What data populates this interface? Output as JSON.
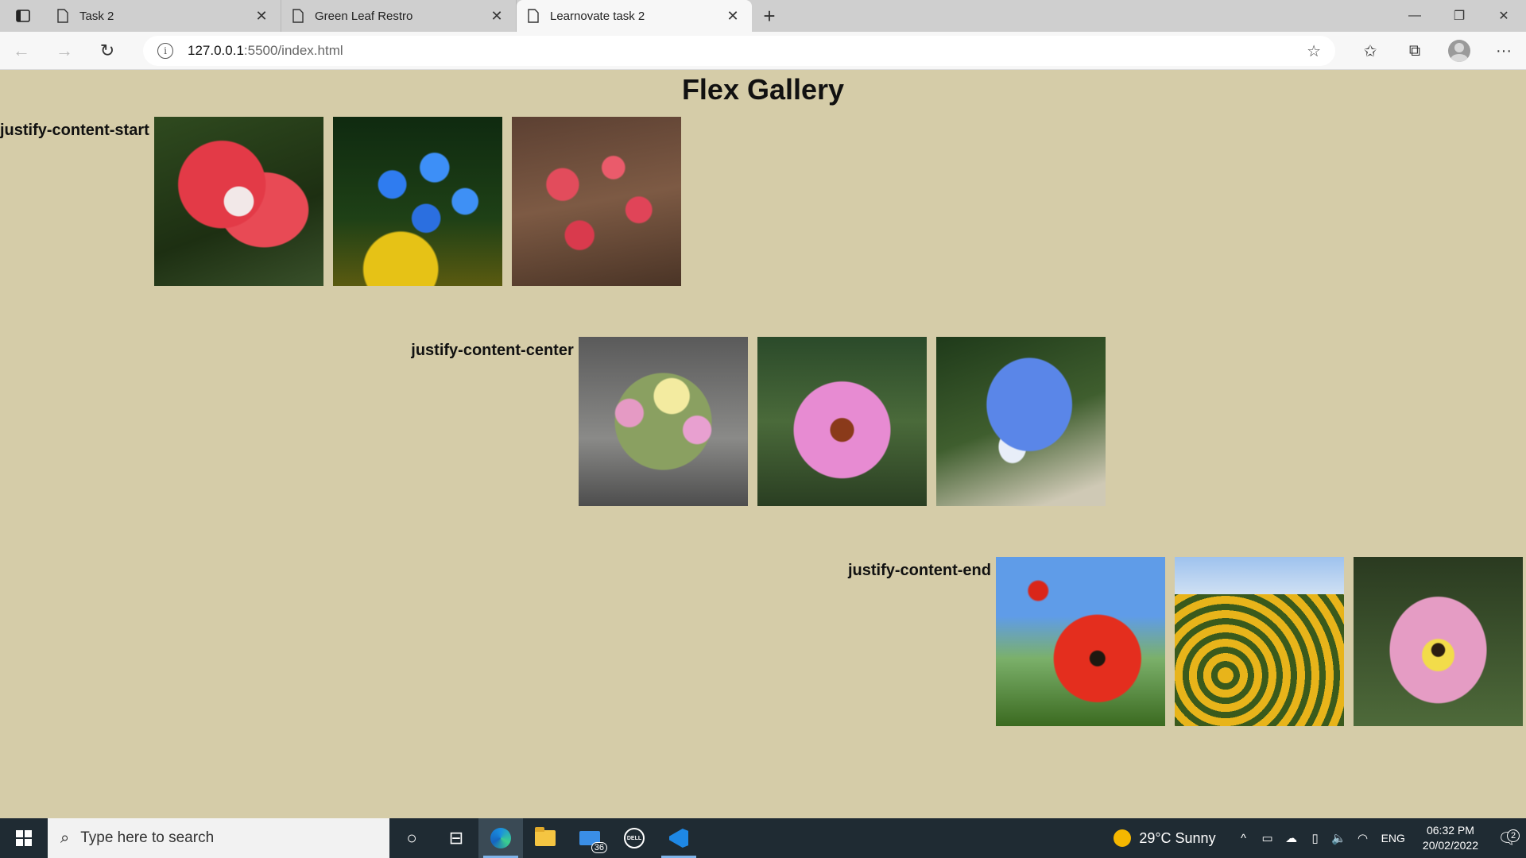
{
  "browser": {
    "tabs": [
      {
        "title": "Task 2",
        "active": false,
        "close": "✕"
      },
      {
        "title": "Green Leaf Restro",
        "active": false,
        "close": "✕"
      },
      {
        "title": "Learnovate task 2",
        "active": true,
        "close": "✕"
      }
    ],
    "new_tab": "+",
    "window_controls": {
      "minimize": "—",
      "restore": "❐",
      "close": "✕"
    },
    "address": {
      "host": "127.0.0.1",
      "path": ":5500/index.html"
    },
    "icons": {
      "back": "arrow-left-icon",
      "forward": "arrow-right-icon",
      "refresh": "refresh-icon",
      "info": "info-icon",
      "add_favorite": "star-plus-icon",
      "favorites": "favorites-icon",
      "collections": "collections-icon",
      "profile": "avatar-icon",
      "menu": "more-icon"
    }
  },
  "page": {
    "title": "Flex Gallery",
    "rows": [
      {
        "label": "justify-content-start",
        "images": [
          "red-white-amaryllis",
          "blue-forget-me-nots",
          "pink-quince-blossom"
        ]
      },
      {
        "label": "justify-content-center",
        "images": [
          "mixed-flower-bouquet",
          "pink-coneflower",
          "blue-morning-glory"
        ]
      },
      {
        "label": "justify-content-end",
        "images": [
          "red-poppy-field",
          "sunflower-field",
          "pink-tulip"
        ]
      }
    ]
  },
  "taskbar": {
    "search_placeholder": "Type here to search",
    "mail_badge": "36",
    "weather": "29°C  Sunny",
    "language": "ENG",
    "time": "06:32 PM",
    "date": "20/02/2022",
    "notifications": "2"
  }
}
